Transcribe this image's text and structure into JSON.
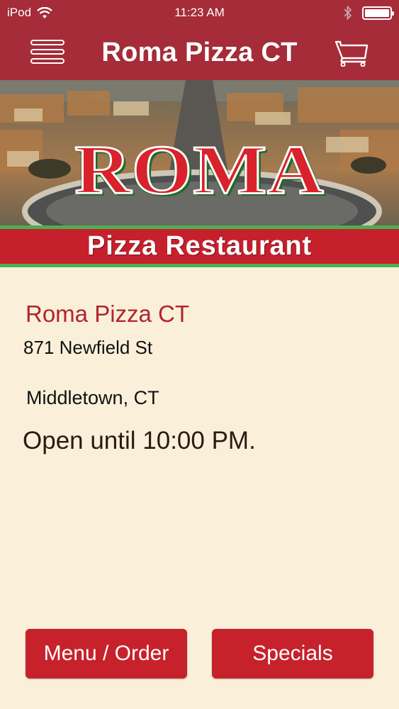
{
  "status_bar": {
    "carrier": "iPod",
    "time": "11:23 AM"
  },
  "nav": {
    "title": "Roma Pizza CT",
    "menu_icon": "hamburger-icon",
    "cart_icon": "cart-icon"
  },
  "banner": {
    "logo_text": "ROMA",
    "subtitle": "Pizza Restaurant"
  },
  "restaurant": {
    "name": "Roma Pizza CT",
    "street": "871 Newfield St",
    "city": "Middletown, CT",
    "hours": "Open until 10:00 PM."
  },
  "buttons": {
    "menu_order": "Menu / Order",
    "specials": "Specials"
  },
  "colors": {
    "header": "#a52c38",
    "accent_red": "#c7212c",
    "background": "#faf0da",
    "stripe_green": "#4caf50"
  }
}
